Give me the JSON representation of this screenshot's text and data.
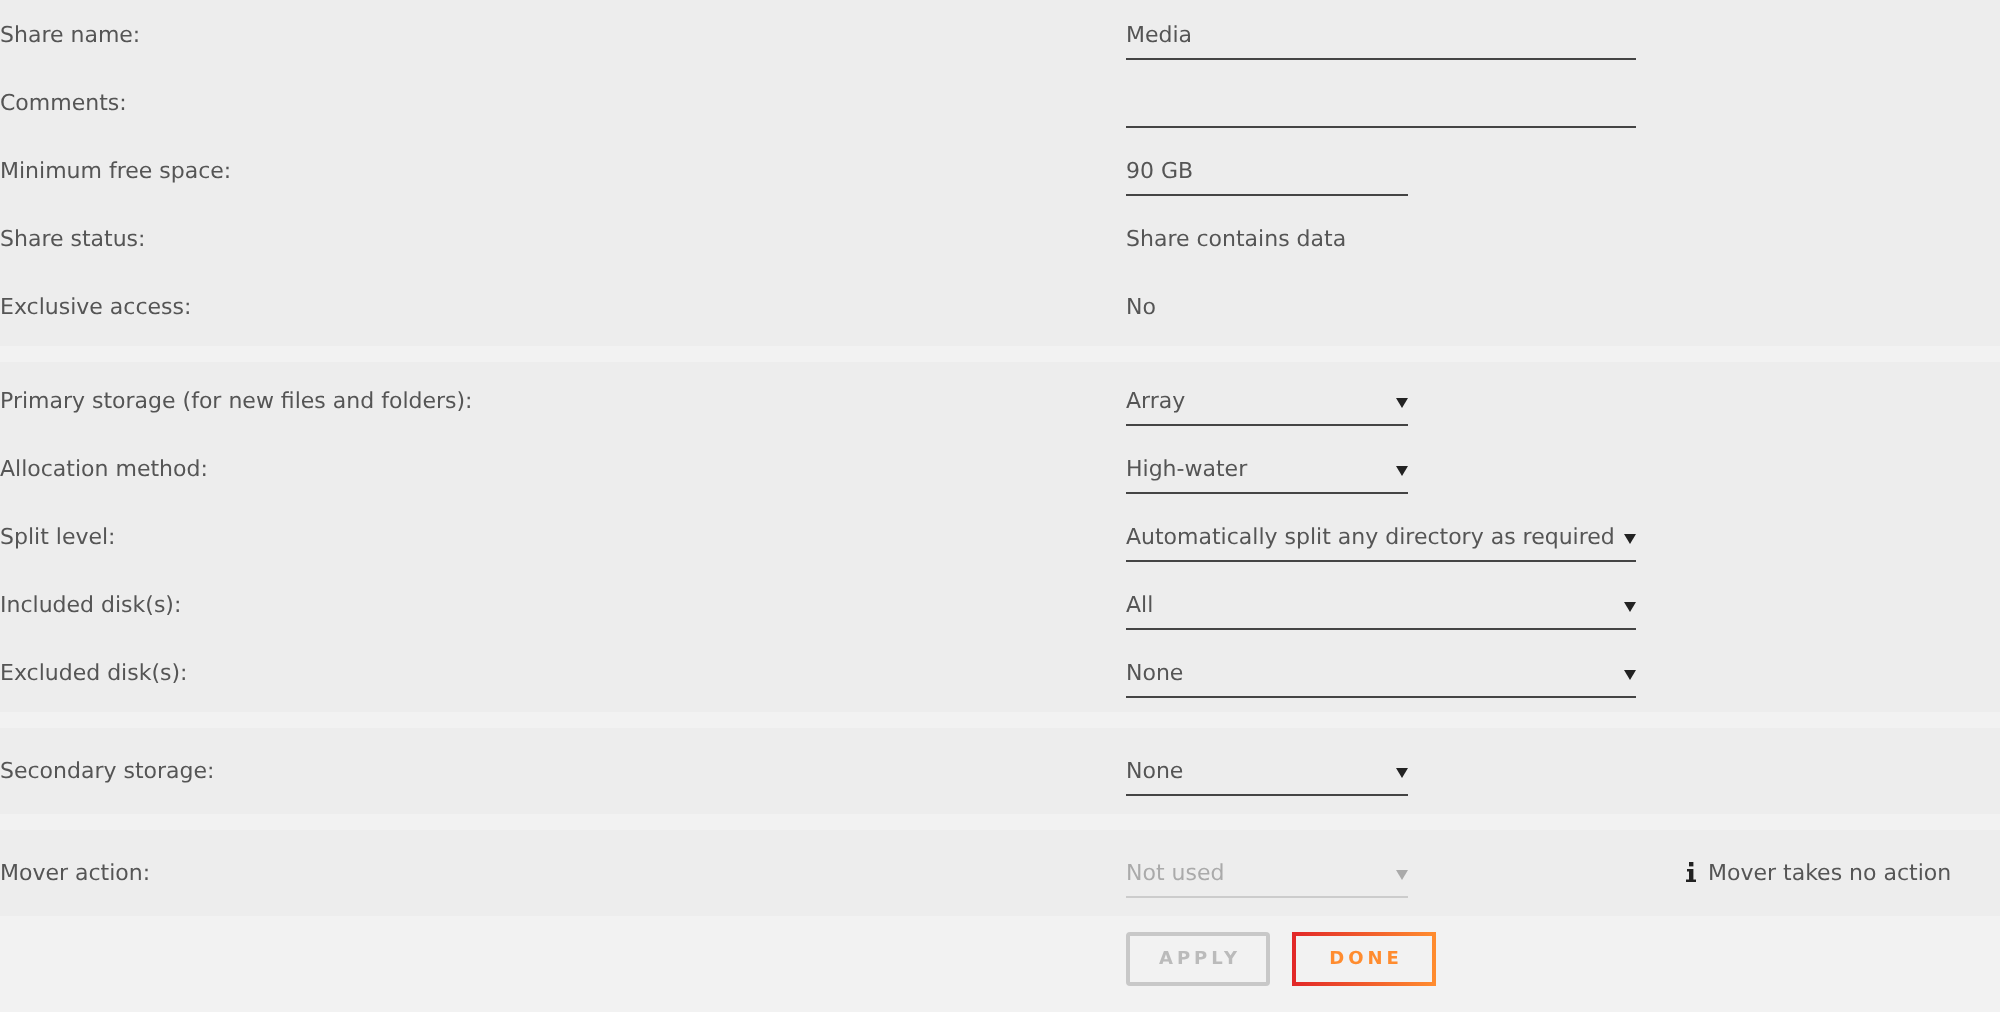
{
  "sections": [
    {
      "rows": [
        {
          "label": "Share name:",
          "kind": "input",
          "value": "Media"
        },
        {
          "label": "Comments:",
          "kind": "input"
        },
        {
          "label": "Minimum free space:",
          "kind": "input",
          "value": "90 GB"
        },
        {
          "label": "Share status:",
          "kind": "text",
          "value": "Share contains data"
        },
        {
          "label": "Exclusive access:",
          "kind": "text",
          "value": "No"
        }
      ]
    },
    {
      "rows": [
        {
          "label": "Primary storage (for new files and folders):",
          "kind": "select",
          "value": "Array",
          "disabled": false
        },
        {
          "label": "Allocation method:",
          "kind": "select",
          "value": "High-water",
          "disabled": false
        },
        {
          "label": "Split level:",
          "kind": "select",
          "value": "Automatically split any directory as required",
          "disabled": false
        },
        {
          "label": "Included disk(s):",
          "kind": "select",
          "value": "All",
          "disabled": false
        },
        {
          "label": "Excluded disk(s):",
          "kind": "select",
          "value": "None",
          "disabled": false
        }
      ]
    },
    {
      "rows": [
        {
          "label": "Secondary storage:",
          "kind": "select",
          "value": "None",
          "disabled": false
        }
      ]
    },
    {
      "rows": [
        {
          "label": "Mover action:",
          "kind": "select",
          "value": "Not used",
          "disabled": true,
          "note": "Mover takes no action"
        }
      ]
    }
  ],
  "buttons": [
    {
      "label": "APPLY",
      "disabled": true
    },
    {
      "label": "DONE",
      "disabled": false
    }
  ]
}
